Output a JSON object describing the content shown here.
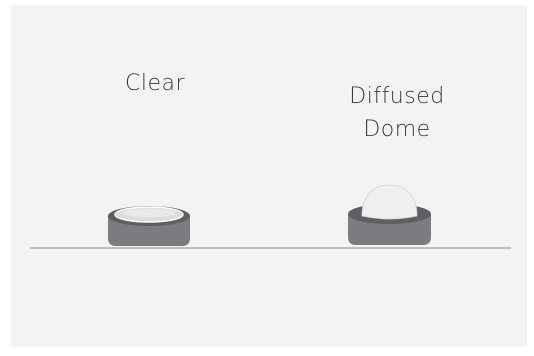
{
  "colors": {
    "background": "#f3f3f5",
    "base_side": "#7c7c80",
    "base_top": "#5f5f63",
    "clear_lens": "#dcdcde",
    "dome": "#efeff0",
    "ground_line": "#8a8a8a",
    "text": "#3a3a3a"
  },
  "items": [
    {
      "id": "clear",
      "label": "Clear",
      "cap_type": "flat-clear-lens"
    },
    {
      "id": "diffused-dome",
      "label": "Diffused\nDome",
      "cap_type": "diffused-dome"
    }
  ]
}
